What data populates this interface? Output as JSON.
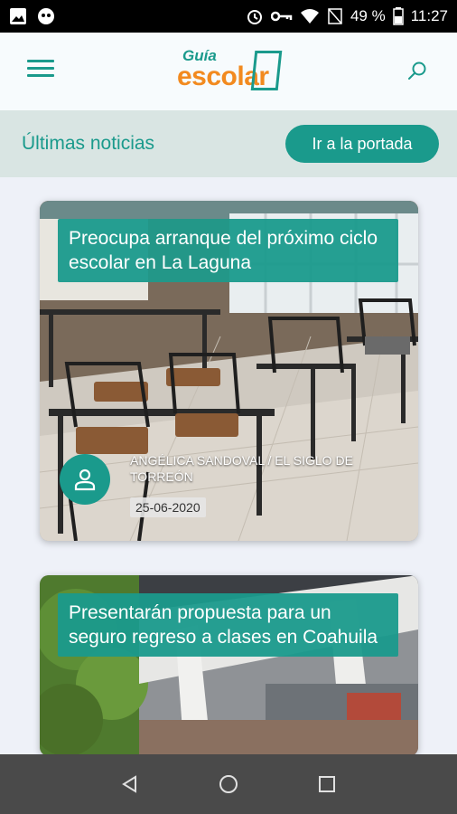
{
  "status_bar": {
    "battery": "49 %",
    "time": "11:27"
  },
  "header": {
    "logo_top": "Guía",
    "logo_bottom": "escolar"
  },
  "section": {
    "title": "Últimas noticias",
    "portada_label": "Ir a la portada"
  },
  "articles": [
    {
      "title": "Preocupa arranque del próximo ciclo escolar en La Laguna",
      "author": "ANGÉLICA SANDOVAL / EL SIGLO DE TORREÓN",
      "date": "25-06-2020"
    },
    {
      "title": "Presentarán propuesta para un seguro regreso a clases en Coahuila"
    }
  ],
  "colors": {
    "accent": "#1a9a8c",
    "orange": "#f28a1f"
  }
}
